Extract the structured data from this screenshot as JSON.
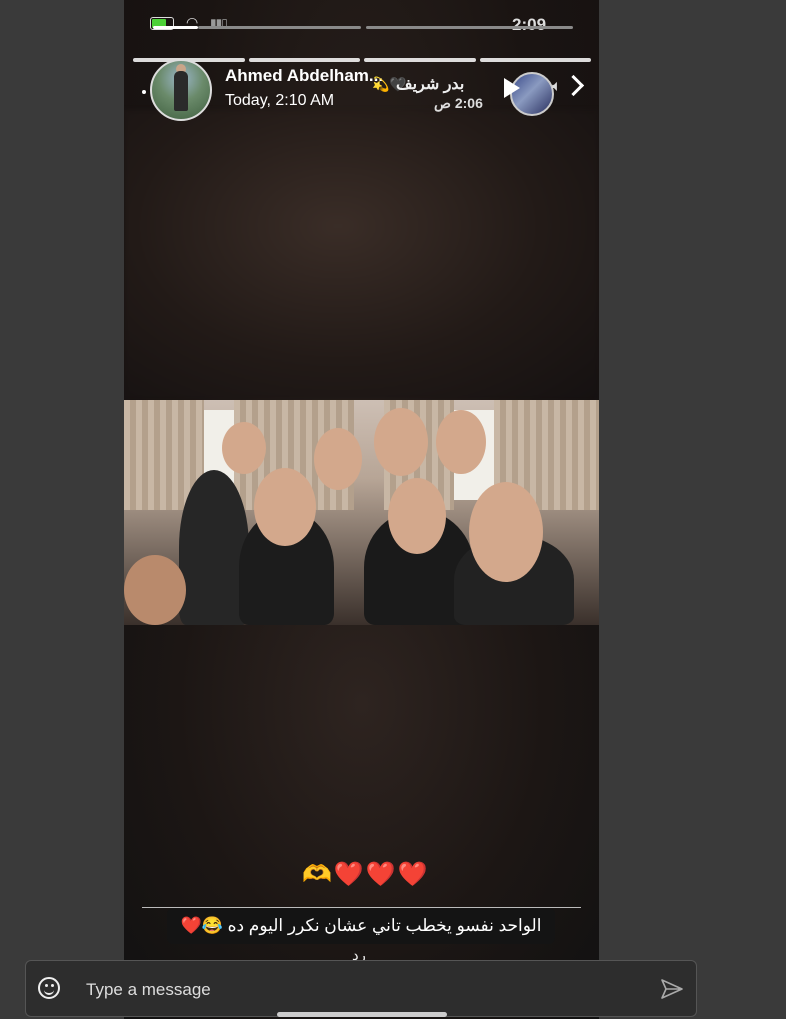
{
  "status_bar": {
    "time": "2:09"
  },
  "header": {
    "sender_name": "Ahmed Abdelham...",
    "timestamp": "Today, 2:10 AM",
    "progress_segments": 4
  },
  "inner_story": {
    "name": "بدر شريف",
    "emoji": "💫🖤",
    "time": "2:06 ص"
  },
  "stickers": {
    "hearts": "🫶❤️❤️❤️"
  },
  "caption": {
    "text": "الواحد نفسو يخطب تاني عشان نكرر اليوم ده 😂❤️"
  },
  "reply": {
    "label": "رد"
  },
  "message_bar": {
    "placeholder": "Type a message"
  },
  "colors": {
    "background": "#3a3a3a",
    "heart": "#e41e3f",
    "battery": "#4cd137"
  }
}
